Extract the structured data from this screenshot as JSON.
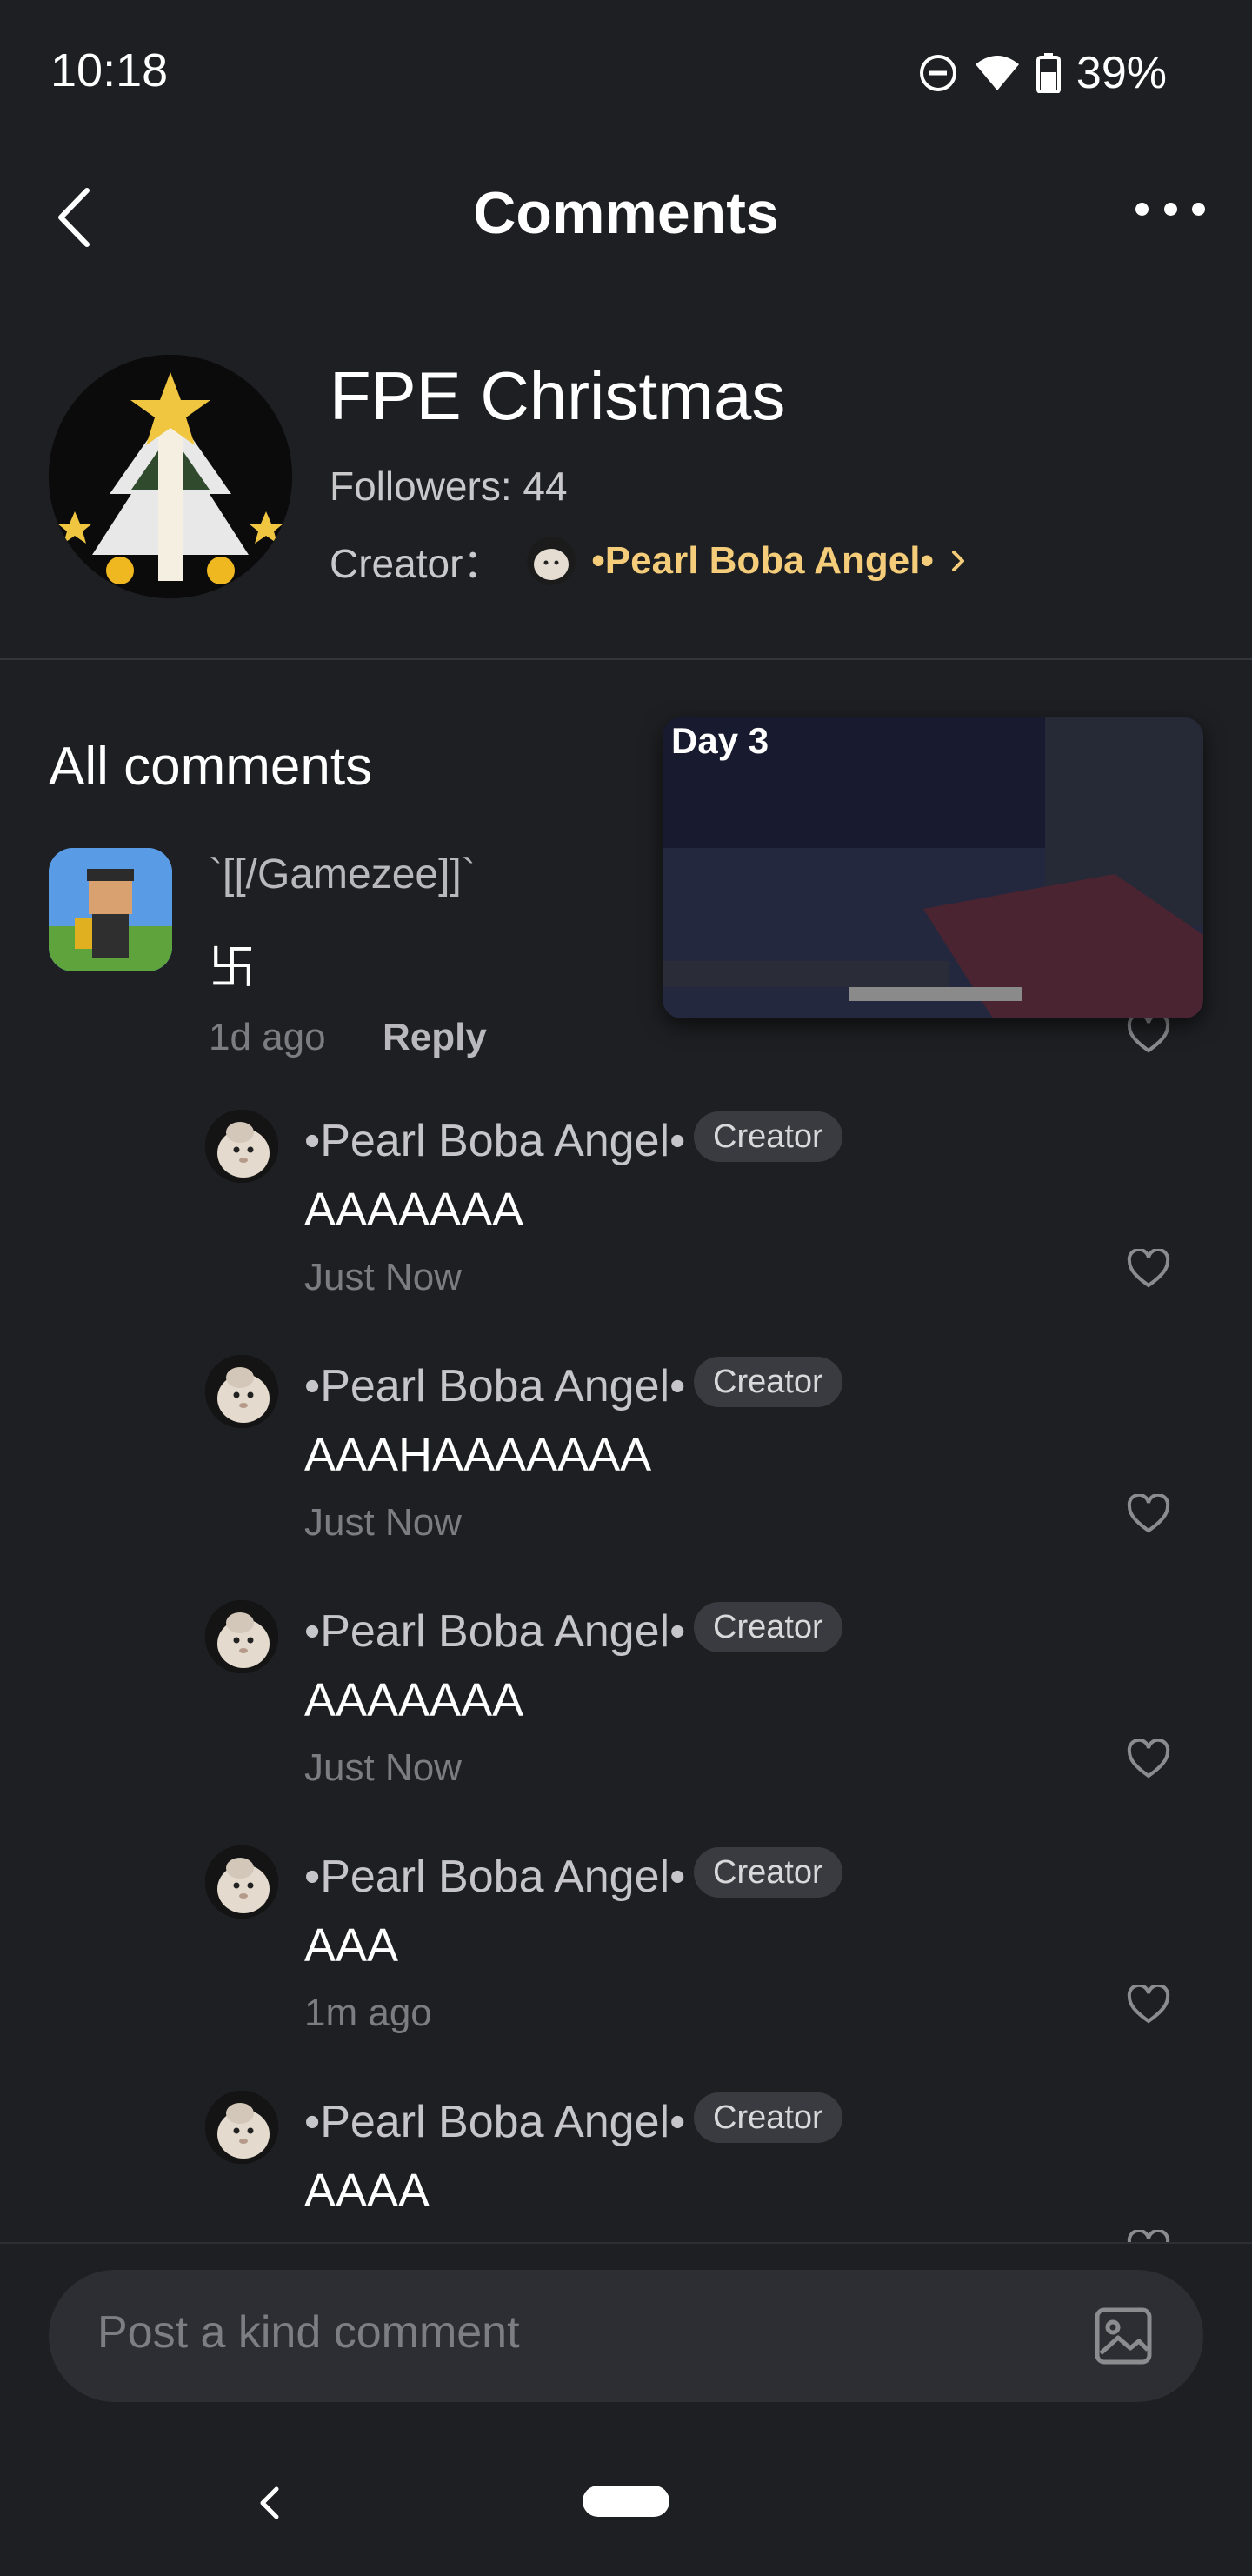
{
  "status_bar": {
    "time": "10:18",
    "battery": "39%"
  },
  "header": {
    "title": "Comments"
  },
  "topic": {
    "name": "FPE Christmas",
    "followers": "Followers: 44",
    "creator_label": "Creator：",
    "creator_name": "•Pearl Boba Angel•"
  },
  "comments_section": {
    "title": "All comments",
    "video_label": "Day 3",
    "comment": {
      "user": "`[[/Gamezee]]`",
      "text": "卐",
      "time": "1d ago",
      "reply_label": "Reply"
    },
    "replies": [
      {
        "user": "•Pearl Boba Angel•",
        "badge": "Creator",
        "text": "AAAAAAA",
        "time": "Just Now"
      },
      {
        "user": "•Pearl Boba Angel•",
        "badge": "Creator",
        "text": "AAAHAAAAAAA",
        "time": "Just Now"
      },
      {
        "user": "•Pearl Boba Angel•",
        "badge": "Creator",
        "text": "AAAAAAA",
        "time": "Just Now"
      },
      {
        "user": "•Pearl Boba Angel•",
        "badge": "Creator",
        "text": "AAA",
        "time": "1m ago"
      },
      {
        "user": "•Pearl Boba Angel•",
        "badge": "Creator",
        "text": "AAAA",
        "time": ""
      }
    ]
  },
  "composer": {
    "placeholder": "Post a kind comment"
  },
  "colors": {
    "background": "#1e1f22",
    "accent": "#f5cd7a",
    "badge_bg": "#3a3b40"
  }
}
